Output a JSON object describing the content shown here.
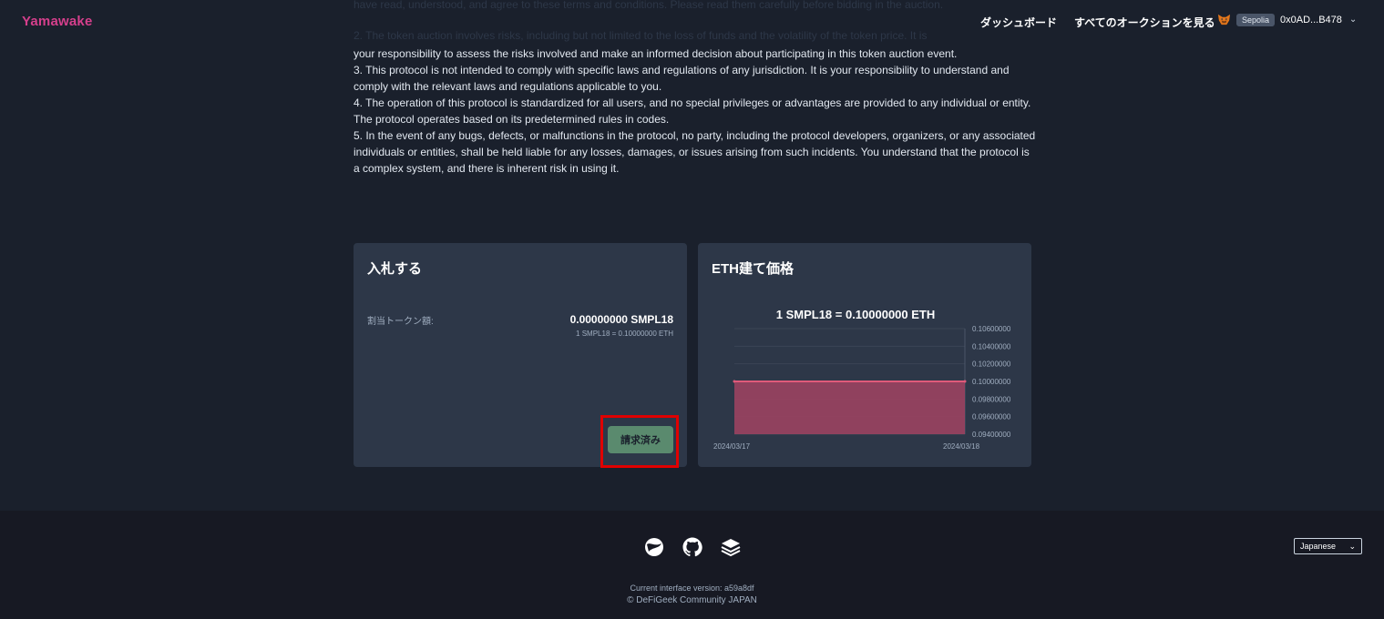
{
  "header": {
    "logo": "Yamawake",
    "nav_dashboard": "ダッシュボード",
    "nav_all_auctions": "すべてのオークションを見る",
    "network": "Sepolia",
    "address": "0x0AD...B478"
  },
  "terms": {
    "faded_line1": "have read, understood, and agree to these terms and conditions. Please read them carefully before bidding in the auction.",
    "faded_line2": "2. The token auction involves risks, including but not limited to the loss of funds and the volatility of the token price. It is",
    "line2_tail": "your responsibility to assess the risks involved and make an informed decision about participating in this token auction event.",
    "item3": "3. This protocol is not intended to comply with specific laws and regulations of any jurisdiction. It is your responsibility to understand and comply with the relevant laws and regulations applicable to you.",
    "item4": "4. The operation of this protocol is standardized for all users, and no special privileges or advantages are provided to any individual or entity. The protocol operates based on its predetermined rules in codes.",
    "item5": "5. In the event of any bugs, defects, or malfunctions in the protocol, no party, including the protocol developers, organizers, or any associated individuals or entities, shall be held liable for any losses, damages, or issues arising from such incidents. You understand that the protocol is a complex system, and there is inherent risk in using it."
  },
  "bid_card": {
    "title": "入札する",
    "alloc_label": "割当トークン額:",
    "alloc_value": "0.00000000 SMPL18",
    "alloc_rate": "1 SMPL18 = 0.10000000 ETH",
    "claim_button": "請求済み"
  },
  "price_card": {
    "title": "ETH建て価格"
  },
  "chart_data": {
    "type": "area",
    "title": "1 SMPL18 = 0.10000000 ETH",
    "x": [
      "2024/03/17",
      "2024/03/18"
    ],
    "series": [
      {
        "values": [
          0.1,
          0.1
        ]
      }
    ],
    "ylim": [
      0.094,
      0.106
    ],
    "yticks": [
      "0.10600000",
      "0.10400000",
      "0.10200000",
      "0.10000000",
      "0.09800000",
      "0.09600000",
      "0.09400000"
    ],
    "xticks": [
      "2024/03/17",
      "2024/03/18"
    ],
    "grid": true,
    "colors": {
      "line": "#e05a7a",
      "fill": "#9b4360"
    }
  },
  "footer": {
    "version": "Current interface version: a59a8df",
    "copyright": "© DeFiGeek Community JAPAN",
    "language": "Japanese"
  }
}
